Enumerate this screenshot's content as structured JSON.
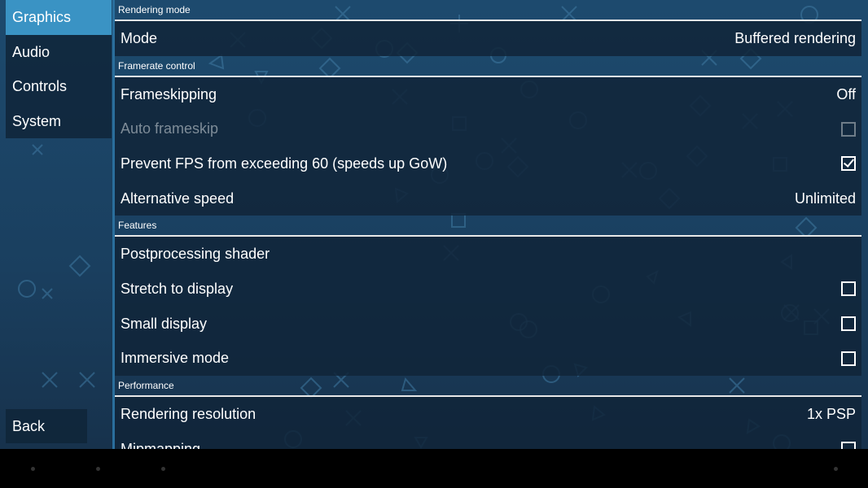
{
  "nav": {
    "items": [
      {
        "label": "Graphics"
      },
      {
        "label": "Audio"
      },
      {
        "label": "Controls"
      },
      {
        "label": "System"
      }
    ],
    "back_label": "Back"
  },
  "sections": {
    "rendering_mode": {
      "title": "Rendering mode",
      "mode": {
        "label": "Mode",
        "value": "Buffered rendering"
      }
    },
    "framerate": {
      "title": "Framerate control",
      "frameskipping": {
        "label": "Frameskipping",
        "value": "Off"
      },
      "auto_frameskip": {
        "label": "Auto frameskip",
        "checked": false,
        "enabled": false
      },
      "prevent_fps": {
        "label": "Prevent FPS from exceeding 60 (speeds up GoW)",
        "checked": true
      },
      "alt_speed": {
        "label": "Alternative speed",
        "value": "Unlimited"
      }
    },
    "features": {
      "title": "Features",
      "postprocessing": {
        "label": "Postprocessing shader"
      },
      "stretch": {
        "label": "Stretch to display",
        "checked": false
      },
      "small_display": {
        "label": "Small display",
        "checked": false
      },
      "immersive": {
        "label": "Immersive mode",
        "checked": false
      }
    },
    "performance": {
      "title": "Performance",
      "render_res": {
        "label": "Rendering resolution",
        "value": "1x PSP"
      },
      "mipmapping": {
        "label": "Mipmapping",
        "checked": false
      }
    }
  },
  "colors": {
    "accent": "#3a93c4",
    "row_bg": "#112438",
    "background": "#1d4a6e"
  }
}
